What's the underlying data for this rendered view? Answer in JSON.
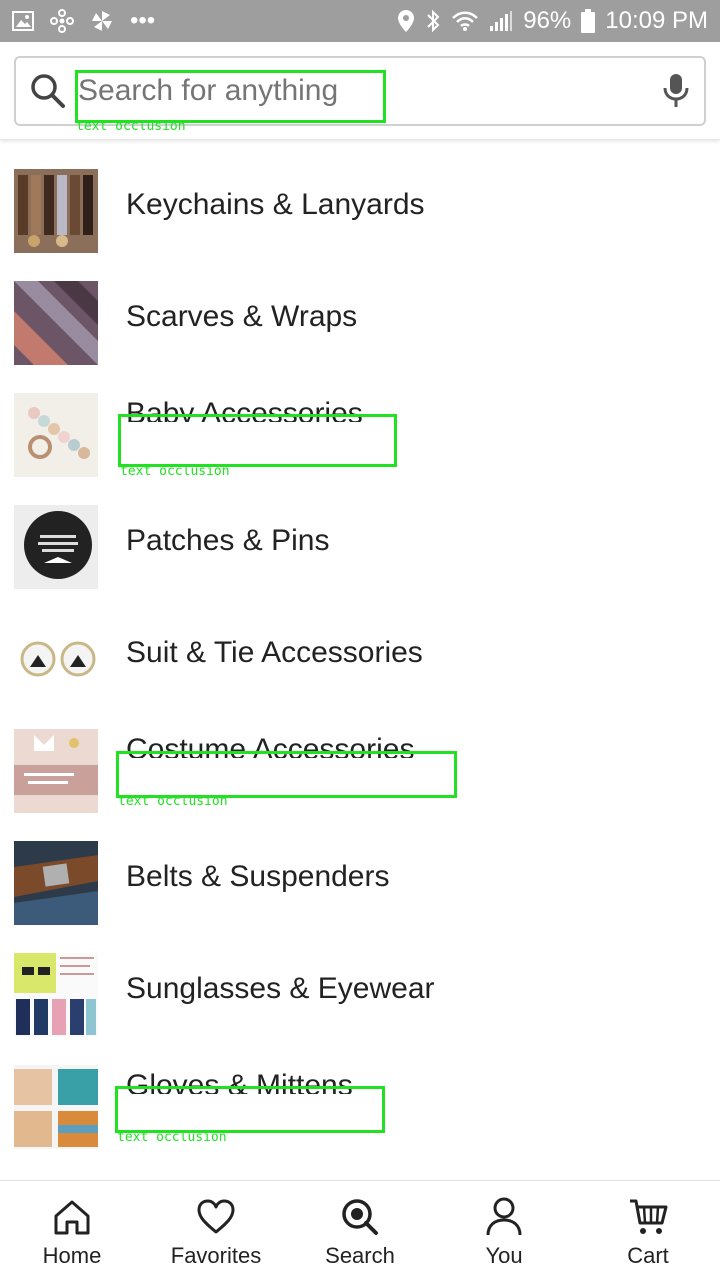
{
  "status_bar": {
    "battery": "96%",
    "time": "10:09 PM",
    "more": "•••",
    "icons": [
      "gallery-icon",
      "fan-icon",
      "pinwheel-icon",
      "location-icon",
      "bluetooth-icon",
      "wifi-icon",
      "signal-icon",
      "battery-icon"
    ]
  },
  "search": {
    "placeholder": "Search for anything",
    "occlusion_label": "text occlusion"
  },
  "categories": [
    {
      "label": "Keychains & Lanyards"
    },
    {
      "label": "Scarves & Wraps"
    },
    {
      "label": "Baby Accessories",
      "occluded": true
    },
    {
      "label": "Patches & Pins"
    },
    {
      "label": "Suit & Tie Accessories"
    },
    {
      "label": "Costume Accessories",
      "occluded": true
    },
    {
      "label": "Belts & Suspenders"
    },
    {
      "label": "Sunglasses & Eyewear"
    },
    {
      "label": "Gloves & Mittens",
      "occluded": true
    }
  ],
  "occlusion_label": "text occlusion",
  "bottom_nav": [
    {
      "label": "Home",
      "icon": "home-icon"
    },
    {
      "label": "Favorites",
      "icon": "heart-icon"
    },
    {
      "label": "Search",
      "icon": "search-icon"
    },
    {
      "label": "You",
      "icon": "user-icon"
    },
    {
      "label": "Cart",
      "icon": "cart-icon"
    }
  ],
  "colors": {
    "status_bar": "#9e9e9e",
    "occlusion_box": "#22e022",
    "text": "#222222"
  }
}
